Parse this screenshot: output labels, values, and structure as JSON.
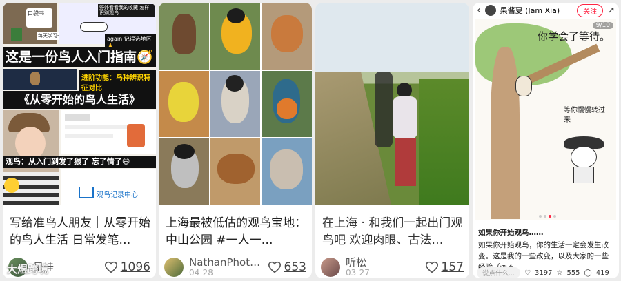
{
  "cards": [
    {
      "title": "写给准鸟人朋友｜从零开始的鸟人生活 日常发笔…",
      "author": "星桂",
      "likes": "1096",
      "image": {
        "label_small": "again 记得选地区🙏",
        "headline": "这是一份鸟人入门指南🧭",
        "tag1": "进阶功能：鸟种辨识特征对比",
        "headline2": "《从零开始的鸟人生活》",
        "bottom_text": "观鸟：从入门到发了狠了 忘了情了😄",
        "logo_text": "观鸟记录中心",
        "note1": "野外看看我的收藏 怎样识别观鸟",
        "note2": "口袋书",
        "note3": "每天学习一点点"
      }
    },
    {
      "title": "上海最被低估的观鸟宝地：中山公园 #一人一…",
      "author": "NathanPhot…",
      "date": "04-28",
      "likes": "653"
    },
    {
      "title": "在上海 · 和我们一起出门观鸟吧 欢迎肉眼、古法…",
      "author": "听松",
      "date": "03-27",
      "likes": "157"
    },
    {
      "author": "果酱夏 (Jam Xia)",
      "follow_label": "关注",
      "page_indicator": "9/10",
      "drawing_text1": "你学会了等待。",
      "drawing_text2": "等你慢慢转过来",
      "caption_title": "如果你开始观鸟……",
      "caption_body": "如果你开始观鸟，你的生活一定会发生改变。这是我的一些改变，以及大家的一些经验（画不",
      "comment_placeholder": "说点什么...",
      "likes": "3197",
      "stars": "555",
      "comments": "419"
    }
  ],
  "watermark": "大煜跨境"
}
